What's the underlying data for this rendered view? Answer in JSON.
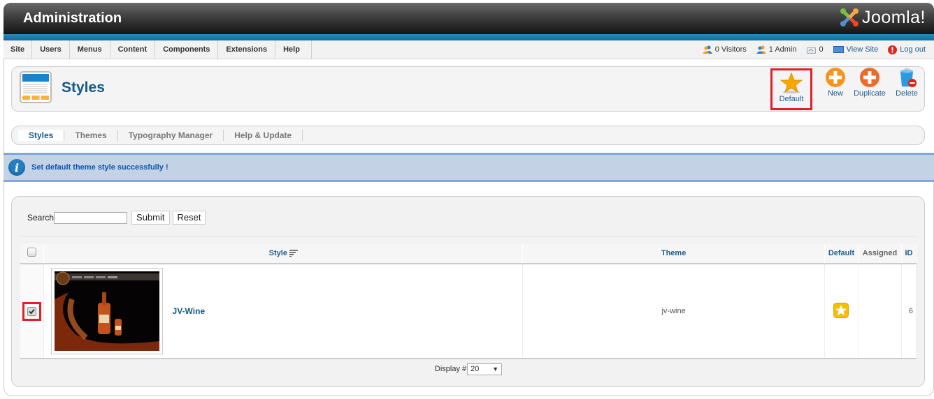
{
  "header": {
    "title": "Administration",
    "logo_text": "Joomla!"
  },
  "menu": {
    "items": [
      {
        "label": "Site"
      },
      {
        "label": "Users"
      },
      {
        "label": "Menus"
      },
      {
        "label": "Content"
      },
      {
        "label": "Components"
      },
      {
        "label": "Extensions"
      },
      {
        "label": "Help"
      }
    ]
  },
  "status": {
    "visitors": "0 Visitors",
    "admins": "1 Admin",
    "messages": "0",
    "view_site": "View Site",
    "logout": "Log out"
  },
  "toolbar": {
    "page_title": "Styles",
    "buttons": [
      {
        "label": "Default",
        "icon": "star-icon"
      },
      {
        "label": "New",
        "icon": "plus-icon"
      },
      {
        "label": "Duplicate",
        "icon": "plus-icon"
      },
      {
        "label": "Delete",
        "icon": "trash-icon"
      }
    ]
  },
  "tabs": [
    {
      "label": "Styles",
      "active": true
    },
    {
      "label": "Themes"
    },
    {
      "label": "Typography Manager"
    },
    {
      "label": "Help & Update"
    }
  ],
  "message": {
    "text": "Set default theme style successfully !"
  },
  "filter": {
    "search_label": "Search",
    "search_value": "",
    "submit_label": "Submit",
    "reset_label": "Reset"
  },
  "table": {
    "columns": [
      "Style",
      "Theme",
      "Default",
      "Assigned",
      "ID"
    ],
    "rows": [
      {
        "checked": true,
        "style": "JV-Wine",
        "theme": "jv-wine",
        "default": true,
        "assigned": "",
        "id": "6"
      }
    ]
  },
  "pagination": {
    "display_label": "Display #",
    "display_value": "20"
  },
  "colors": {
    "accent": "#165a8c",
    "highlight": "#e41e26",
    "message_bg": "#c3d2e5"
  }
}
